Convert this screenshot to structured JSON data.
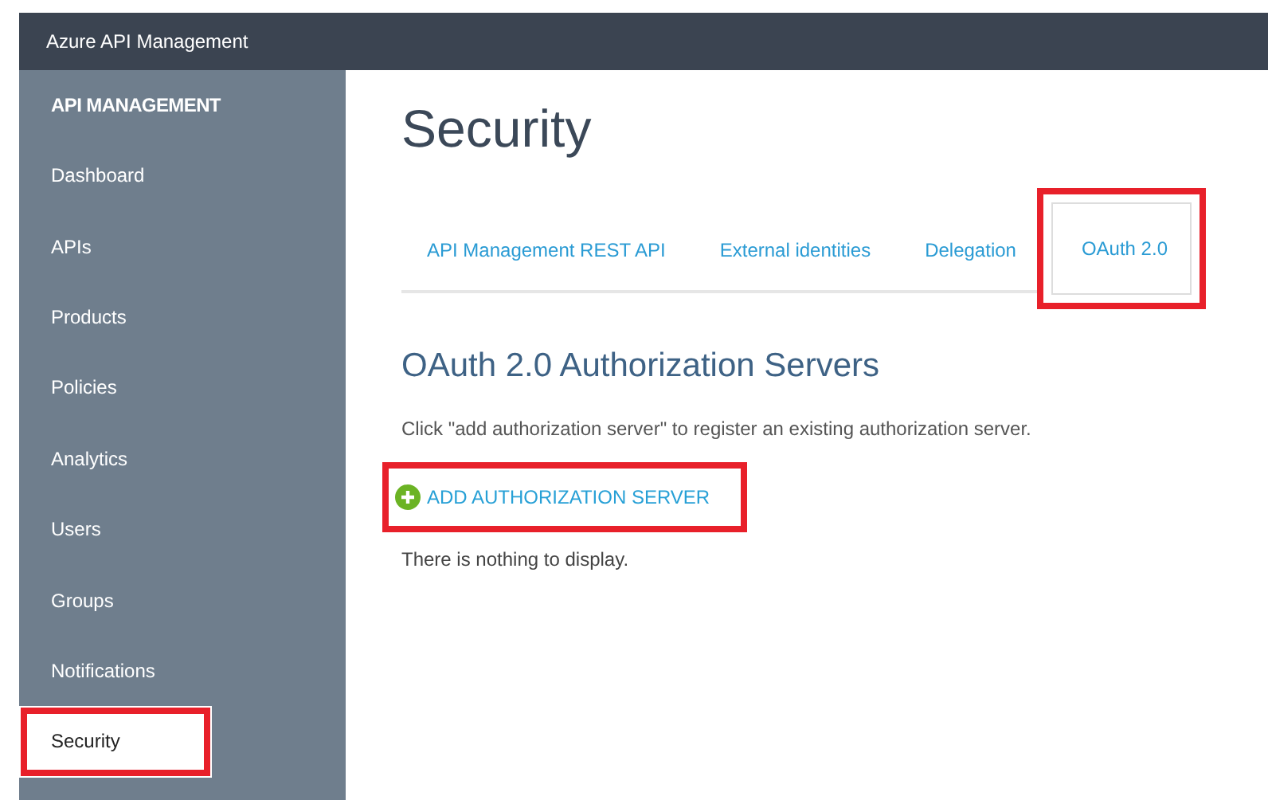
{
  "window": {
    "title": "Azure API Management"
  },
  "sidebar": {
    "heading": "API MANAGEMENT",
    "items": [
      {
        "label": "Dashboard",
        "selected": false,
        "highlighted": false
      },
      {
        "label": "APIs",
        "selected": false,
        "highlighted": false
      },
      {
        "label": "Products",
        "selected": false,
        "highlighted": false
      },
      {
        "label": "Policies",
        "selected": false,
        "highlighted": false
      },
      {
        "label": "Analytics",
        "selected": false,
        "highlighted": false
      },
      {
        "label": "Users",
        "selected": false,
        "highlighted": false
      },
      {
        "label": "Groups",
        "selected": false,
        "highlighted": false
      },
      {
        "label": "Notifications",
        "selected": false,
        "highlighted": false
      },
      {
        "label": "Security",
        "selected": true,
        "highlighted": true
      }
    ]
  },
  "page_title": "Security",
  "tabs": [
    {
      "label": "API Management REST API",
      "selected": false,
      "highlighted": false
    },
    {
      "label": "External identities",
      "selected": false,
      "highlighted": false
    },
    {
      "label": "Delegation",
      "selected": false,
      "highlighted": false
    },
    {
      "label": "OAuth 2.0",
      "selected": true,
      "highlighted": true
    }
  ],
  "section": {
    "title": "OAuth 2.0 Authorization Servers",
    "description": "Click \"add authorization server\" to register an existing authorization server.",
    "add_button": {
      "label": "ADD AUTHORIZATION SERVER",
      "highlighted": true
    },
    "empty_message": "There is nothing to display."
  }
}
